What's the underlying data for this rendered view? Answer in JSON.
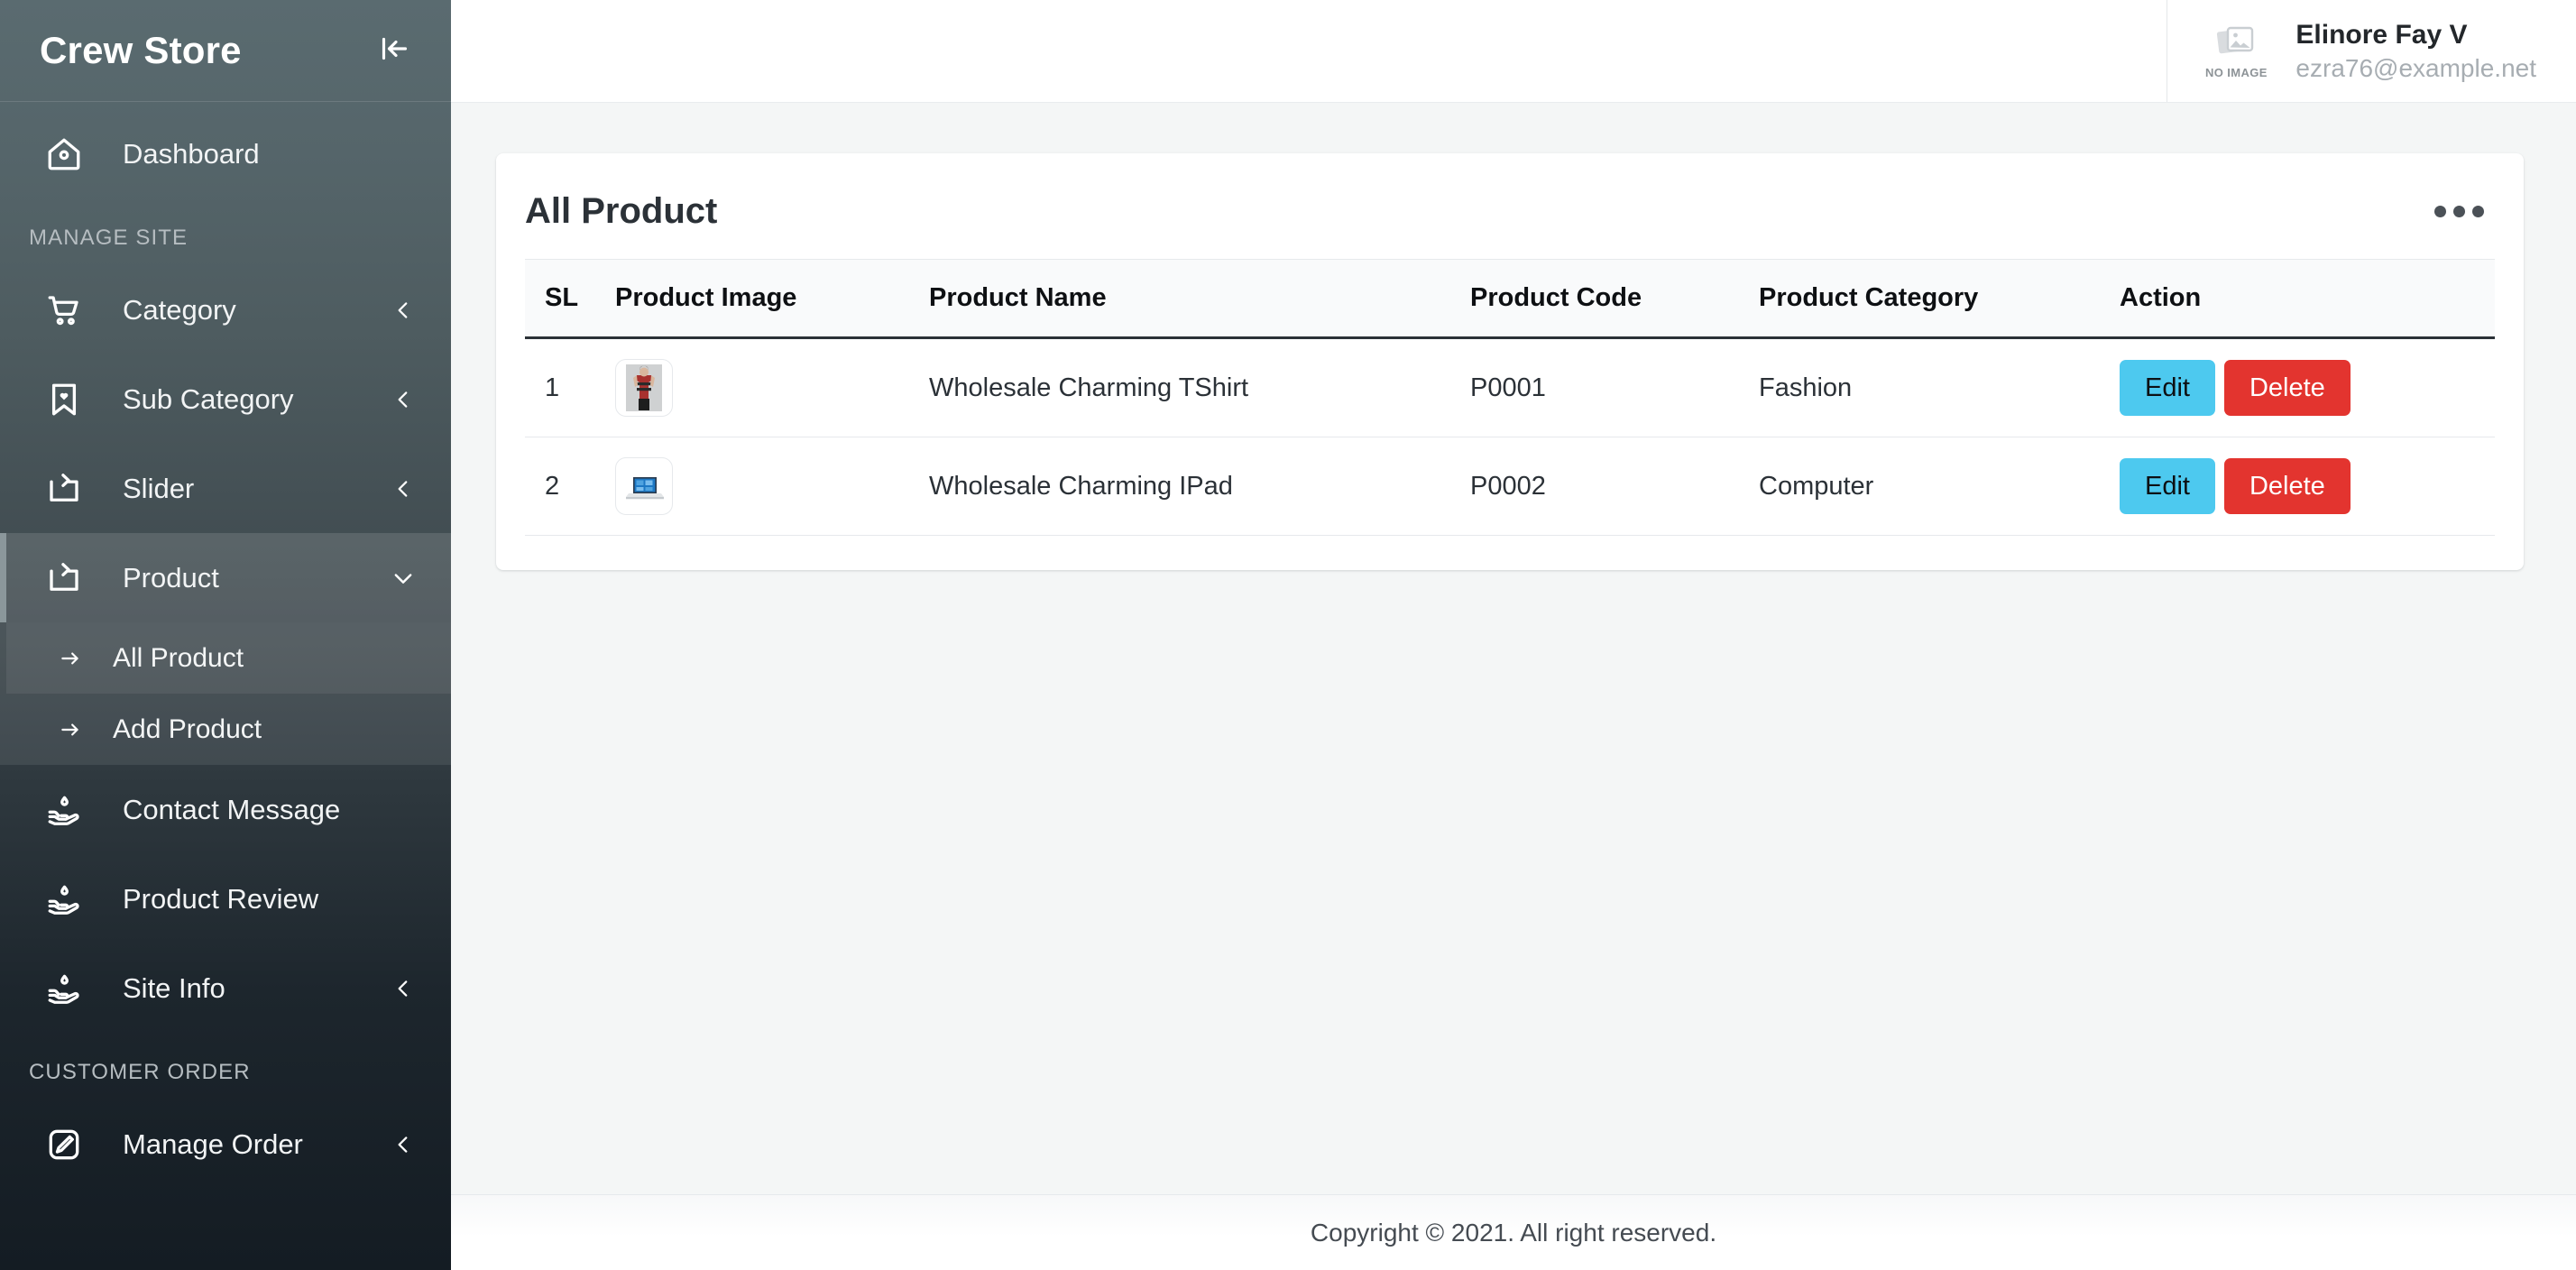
{
  "sidebar": {
    "brand": "Crew Store",
    "collapse_icon": "arrow-to-left-icon",
    "groups": [
      {
        "label": null,
        "items": [
          {
            "label": "Dashboard",
            "icon": "home-icon",
            "chevron": null,
            "active": false
          }
        ]
      },
      {
        "label": "MANAGE SITE",
        "items": [
          {
            "label": "Category",
            "icon": "shopping-cart-icon",
            "chevron": "chevron-left-icon",
            "active": false
          },
          {
            "label": "Sub Category",
            "icon": "bookmark-heart-icon",
            "chevron": "chevron-left-icon",
            "active": false
          },
          {
            "label": "Slider",
            "icon": "slider-share-icon",
            "chevron": "chevron-left-icon",
            "active": false
          },
          {
            "label": "Product",
            "icon": "slider-share-icon",
            "chevron": "chevron-down-icon",
            "active": true,
            "submenu": [
              {
                "label": "All Product",
                "icon": "arrow-right-icon",
                "selected": true
              },
              {
                "label": "Add Product",
                "icon": "arrow-right-icon",
                "selected": false
              }
            ]
          },
          {
            "label": "Contact Message",
            "icon": "hand-drop-icon",
            "chevron": null,
            "active": false
          },
          {
            "label": "Product Review",
            "icon": "hand-drop-icon",
            "chevron": null,
            "active": false
          },
          {
            "label": "Site Info",
            "icon": "hand-drop-icon",
            "chevron": "chevron-left-icon",
            "active": false
          }
        ]
      },
      {
        "label": "CUSTOMER ORDER",
        "items": [
          {
            "label": "Manage Order",
            "icon": "edit-square-icon",
            "chevron": "chevron-left-icon",
            "active": false
          }
        ]
      }
    ]
  },
  "topbar": {
    "avatar_placeholder_text": "NO IMAGE",
    "user_name": "Elinore Fay V",
    "user_email": "ezra76@example.net"
  },
  "card": {
    "title": "All Product",
    "menu_icon": "kebab-menu-icon"
  },
  "table": {
    "columns": [
      "SL",
      "Product Image",
      "Product Name",
      "Product Code",
      "Product Category",
      "Action"
    ],
    "rows": [
      {
        "sl": "1",
        "image": "tshirt-model-thumbnail",
        "name": "Wholesale Charming TShirt",
        "code": "P0001",
        "category": "Fashion",
        "edit_label": "Edit",
        "delete_label": "Delete"
      },
      {
        "sl": "2",
        "image": "laptop-thumbnail",
        "name": "Wholesale Charming IPad",
        "code": "P0002",
        "category": "Computer",
        "edit_label": "Edit",
        "delete_label": "Delete"
      }
    ]
  },
  "footer": {
    "copyright": "Copyright © 2021. All right reserved."
  },
  "colors": {
    "edit_button": "#4dc9ef",
    "delete_button": "#e3342f",
    "sidebar_top": "#5a6b70",
    "sidebar_bottom": "#141c23",
    "page_bg": "#f4f6f6"
  }
}
